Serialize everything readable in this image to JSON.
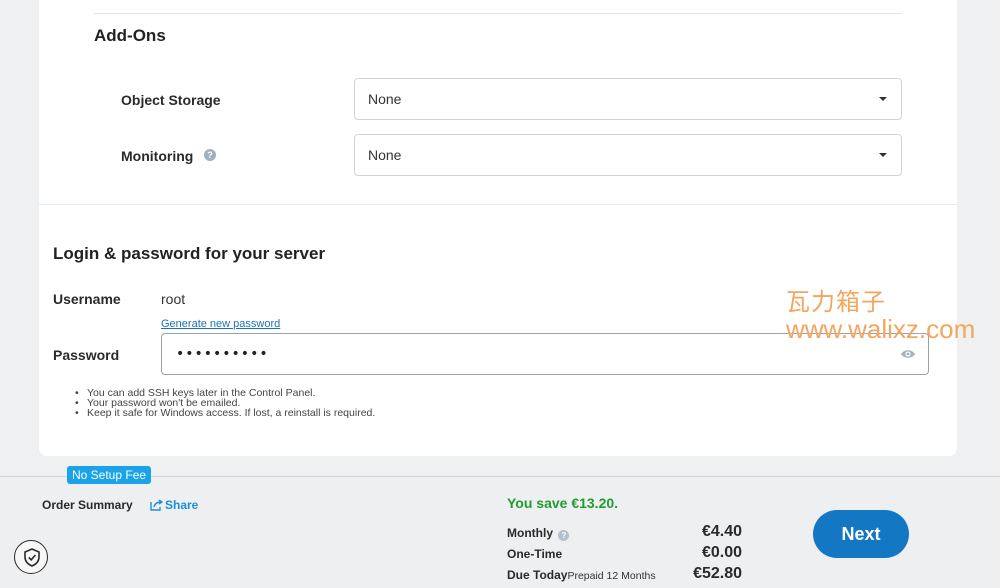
{
  "addons": {
    "title": "Add-Ons",
    "object_storage": {
      "label": "Object Storage",
      "value": "None"
    },
    "monitoring": {
      "label": "Monitoring",
      "value": "None",
      "help_icon": "?"
    }
  },
  "login": {
    "title": "Login & password for your server",
    "username_label": "Username",
    "username_value": "root",
    "generate_link": "Generate new password",
    "password_label": "Password",
    "password_value": "••••••••••",
    "notes": [
      "You can add SSH keys later in the Control Panel.",
      "Your password won't be emailed.",
      "Keep it safe for Windows access. If lost, a reinstall is required."
    ]
  },
  "watermark": {
    "line1": "瓦力箱子",
    "line2": "www.walixz.com"
  },
  "summary": {
    "badge": "No Setup Fee",
    "title": "Order Summary",
    "share": "Share",
    "save_text": "You save €13.20.",
    "monthly_label": "Monthly",
    "monthly_price": "€4.40",
    "onetime_label": "One-Time",
    "onetime_price": "€0.00",
    "due_label": "Due Today",
    "due_sub": "Prepaid 12 Months",
    "due_price": "€52.80",
    "next_label": "Next"
  },
  "colors": {
    "accent": "#1477c4",
    "link": "#1d8fd8",
    "success": "#1f9d2f",
    "badge": "#1aa3e8"
  },
  "icons": [
    "help-icon",
    "eye-icon",
    "share-icon",
    "shield-check-icon",
    "chevron-down-icon"
  ]
}
